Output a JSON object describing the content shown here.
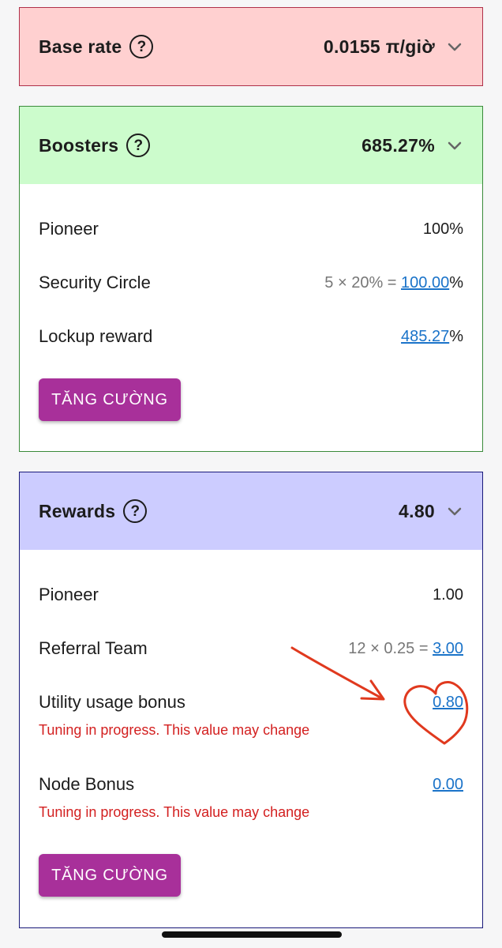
{
  "base_rate": {
    "title": "Base rate",
    "value": "0.0155 π/giờ"
  },
  "boosters": {
    "title": "Boosters",
    "value": "685.27%",
    "rows": {
      "pioneer": {
        "label": "Pioneer",
        "value": "100%"
      },
      "security_circle": {
        "label": "Security Circle",
        "formula": "5 × 20% = ",
        "value": "100.00",
        "suffix": "%"
      },
      "lockup_reward": {
        "label": "Lockup reward",
        "value": "485.27",
        "suffix": "%"
      }
    },
    "button_label": "TĂNG CƯỜNG"
  },
  "rewards": {
    "title": "Rewards",
    "value": "4.80",
    "rows": {
      "pioneer": {
        "label": "Pioneer",
        "value": "1.00"
      },
      "referral_team": {
        "label": "Referral Team",
        "formula": "12 × 0.25 = ",
        "value": "3.00"
      },
      "utility_usage_bonus": {
        "label": "Utility usage bonus",
        "value": "0.80",
        "warning": "Tuning in progress. This value may change"
      },
      "node_bonus": {
        "label": "Node Bonus",
        "value": "0.00",
        "warning": "Tuning in progress. This value may change"
      }
    },
    "button_label": "TĂNG CƯỜNG"
  },
  "icons": [
    "help-icon",
    "chevron-down-icon"
  ],
  "colors": {
    "base_rate_header": "#ffd0d0",
    "base_rate_border": "#b0304a",
    "boosters_header": "#ccfccc",
    "boosters_border": "#3a8a3a",
    "rewards_header": "#ccccff",
    "rewards_border": "#1a1a7a",
    "link": "#1a73c9",
    "warning": "#d32020",
    "button": "#a8309a",
    "annotation": "#e0391e"
  }
}
